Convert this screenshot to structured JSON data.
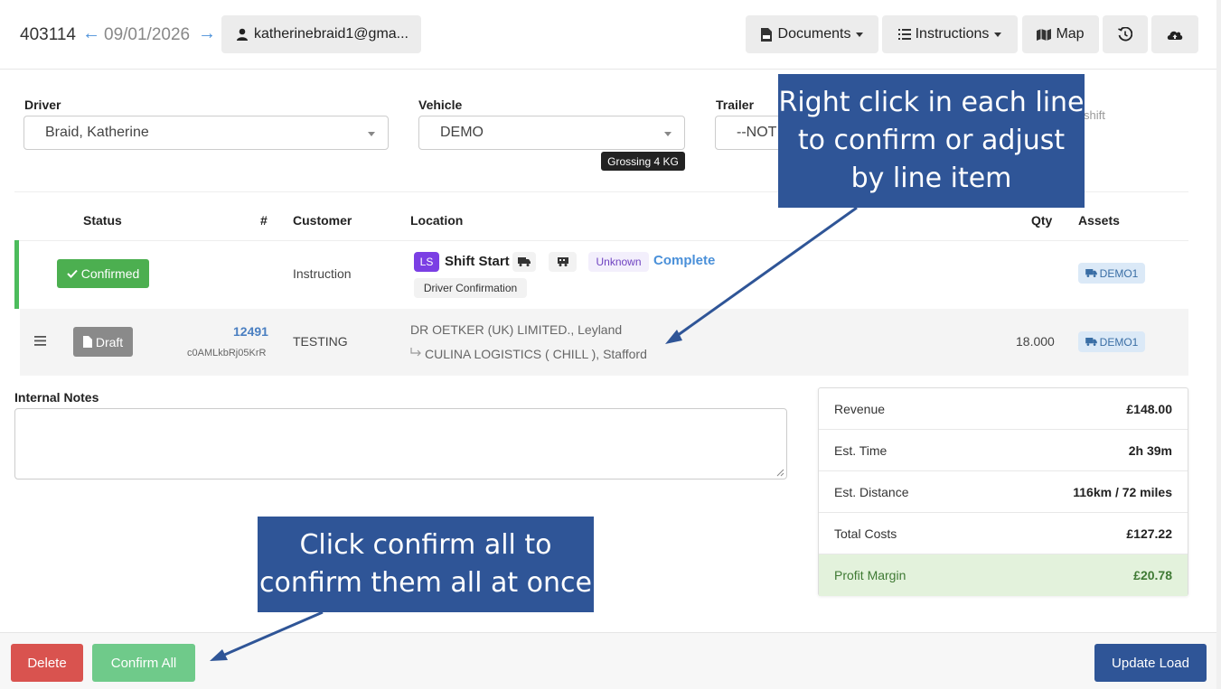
{
  "header": {
    "load_id": "403114",
    "date": "09/01/2026",
    "user_email": "katherinebraid1@gma...",
    "buttons": {
      "documents": "Documents",
      "instructions": "Instructions",
      "map": "Map"
    }
  },
  "form": {
    "driver_label": "Driver",
    "driver_value": "Braid, Katherine",
    "vehicle_label": "Vehicle",
    "vehicle_value": "DEMO",
    "gross_badge": "Grossing 4 KG",
    "trailer_label": "Trailer",
    "trailer_value": "--NOT",
    "shift_text": "shift"
  },
  "table": {
    "headers": {
      "status": "Status",
      "number": "#",
      "customer": "Customer",
      "location": "Location",
      "qty": "Qty",
      "assets": "Assets"
    },
    "rows": [
      {
        "status": "Confirmed",
        "customer": "Instruction",
        "location_badge": "LS",
        "location_title": "Shift Start",
        "location_tag": "Unknown",
        "location_state": "Complete",
        "location_sub": "Driver Confirmation",
        "asset": "DEMO1"
      },
      {
        "status": "Draft",
        "number": "12491",
        "ref": "c0AMLkbRj05KrR",
        "customer": "TESTING",
        "from": "DR OETKER (UK) LIMITED., Leyland",
        "to": "CULINA LOGISTICS ( CHILL ), Stafford",
        "qty": "18.000",
        "asset": "DEMO1"
      }
    ]
  },
  "notes": {
    "label": "Internal Notes",
    "value": ""
  },
  "summary": [
    {
      "label": "Revenue",
      "value": "£148.00"
    },
    {
      "label": "Est. Time",
      "value": "2h 39m"
    },
    {
      "label": "Est. Distance",
      "value": "116km / 72 miles"
    },
    {
      "label": "Total Costs",
      "value": "£127.22"
    },
    {
      "label": "Profit Margin",
      "value": "£20.78"
    }
  ],
  "footer": {
    "delete": "Delete",
    "confirm_all": "Confirm All",
    "update_load": "Update Load"
  },
  "callouts": {
    "right_click_lines": [
      "Right click in each line",
      "to confirm or adjust",
      "by line item"
    ],
    "confirm_all_lines": [
      "Click confirm all to",
      "confirm them all at once"
    ]
  },
  "colors": {
    "accent_blue": "#4a90d9",
    "confirmed_green": "#4caf50",
    "delete_red": "#d9534f",
    "confirm_all_green": "#6fca8a",
    "update_navy": "#2f5597",
    "callout_navy": "#2f5597",
    "ls_purple": "#7b3fe4"
  },
  "icons": [
    "user-icon",
    "pdf-file-icon",
    "list-icon",
    "map-icon",
    "history-icon",
    "cloud-upload-icon",
    "truck-icon",
    "trailer-icon",
    "check-icon",
    "file-icon",
    "drag-handle-icon",
    "sub-arrow-icon"
  ]
}
